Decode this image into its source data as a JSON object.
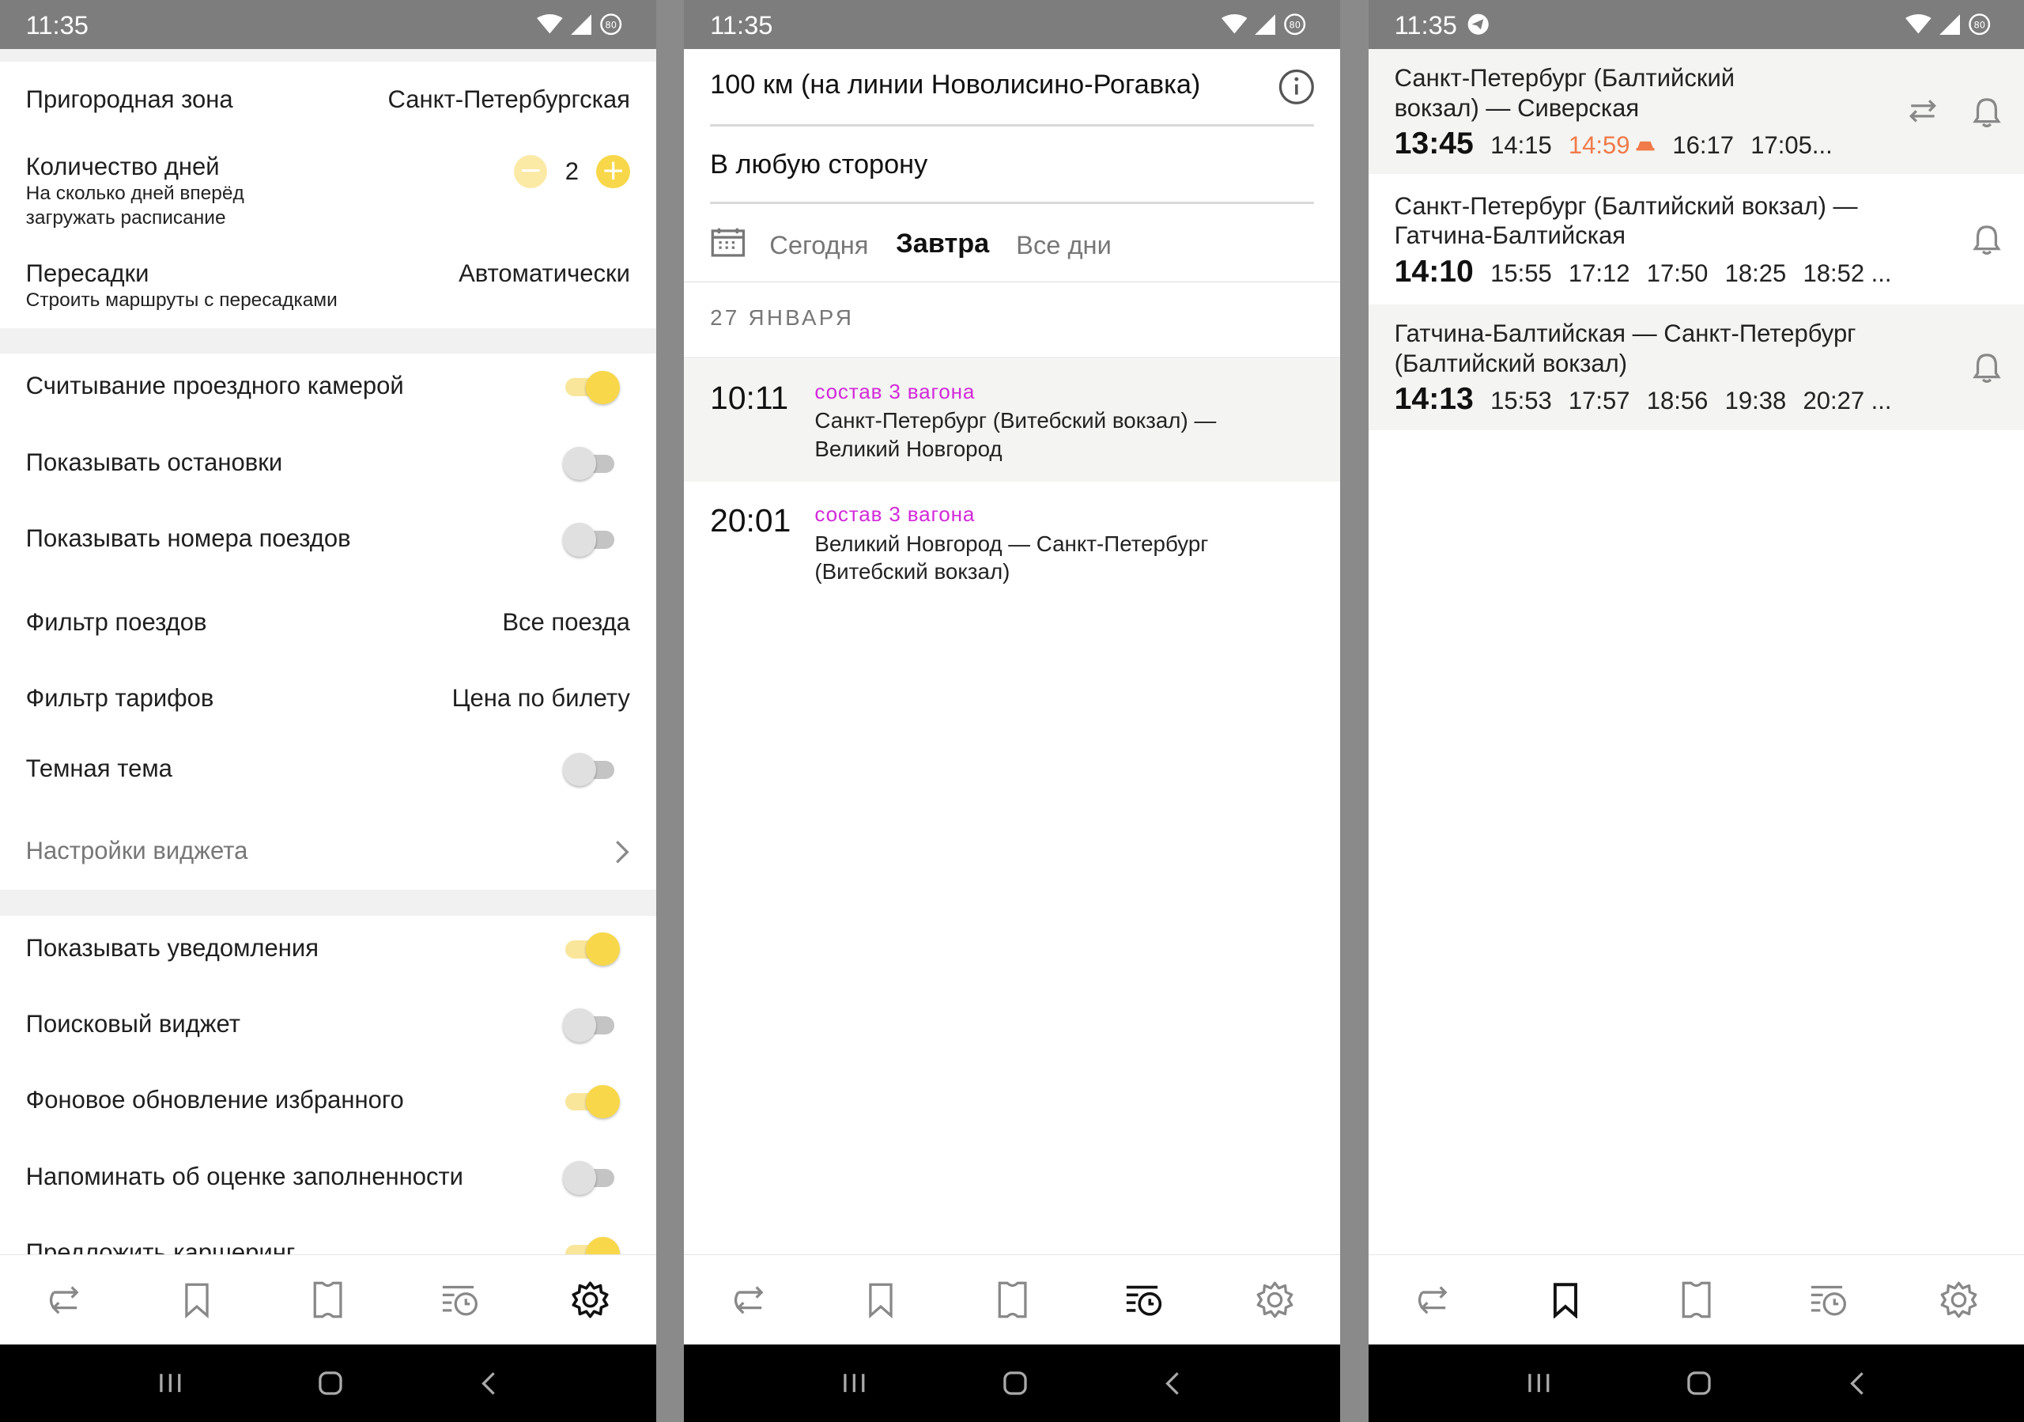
{
  "status_time": "11:35",
  "battery_label": "80",
  "screen1": {
    "rows": [
      {
        "label": "Пригородная зона",
        "value": "Санкт-Петербургская"
      },
      {
        "label": "Количество дней",
        "sub1": "На сколько дней вперёд",
        "sub2": "загружать расписание",
        "count": "2"
      },
      {
        "label": "Пересадки",
        "sub": "Строить маршруты с пересадками",
        "value": "Автоматически"
      },
      {
        "label": "Считывание проездного камерой",
        "toggle": "on"
      },
      {
        "label": "Показывать остановки",
        "toggle": "off"
      },
      {
        "label": "Показывать номера поездов",
        "toggle": "off"
      },
      {
        "label": "Фильтр поездов",
        "value": "Все поезда"
      },
      {
        "label": "Фильтр тарифов",
        "value": "Цена по билету"
      },
      {
        "label": "Темная тема",
        "toggle": "off"
      },
      {
        "label": "Настройки виджета"
      },
      {
        "label": "Показывать уведомления",
        "toggle": "on"
      },
      {
        "label": "Поисковый виджет",
        "toggle": "off"
      },
      {
        "label": "Фоновое обновление избранного",
        "toggle": "on"
      },
      {
        "label": "Напоминать об оценке заполненности",
        "toggle": "off"
      },
      {
        "label": "Предложить каршеринг",
        "toggle": "on"
      }
    ]
  },
  "screen2": {
    "title": "100 км (на линии Новолисино-Рогавка)",
    "direction": "В любую сторону",
    "days": {
      "today": "Сегодня",
      "tomorrow": "Завтра",
      "all": "Все дни"
    },
    "date_header": "27 ЯНВАРЯ",
    "trips": [
      {
        "time": "10:11",
        "tag": "состав 3 вагона",
        "route1": "Санкт-Петербург (Витебский вокзал) —",
        "route2": "Великий Новгород"
      },
      {
        "time": "20:01",
        "tag": "состав 3 вагона",
        "route1": "Великий Новгород — Санкт-Петербург",
        "route2": "(Витебский вокзал)"
      }
    ]
  },
  "screen3": {
    "favorites": [
      {
        "line1": "Санкт-Петербург (Балтийский",
        "line2": "вокзал) — Сиверская",
        "first": "13:45",
        "times": [
          "14:15",
          "14:59",
          "16:17",
          "17:05..."
        ],
        "highlight_index": 1
      },
      {
        "line1": "Санкт-Петербург (Балтийский вокзал) —",
        "line2": "Гатчина-Балтийская",
        "first": "14:10",
        "times": [
          "15:55",
          "17:12",
          "17:50",
          "18:25",
          "18:52 ..."
        ]
      },
      {
        "line1": "Гатчина-Балтийская — Санкт-Петербург",
        "line2": "(Балтийский вокзал)",
        "first": "14:13",
        "times": [
          "15:53",
          "17:57",
          "18:56",
          "19:38",
          "20:27 ..."
        ]
      }
    ]
  },
  "colors": {
    "accent": "#f8d84a",
    "tag": "#d22ad9",
    "highlight": "#f07a4a"
  }
}
